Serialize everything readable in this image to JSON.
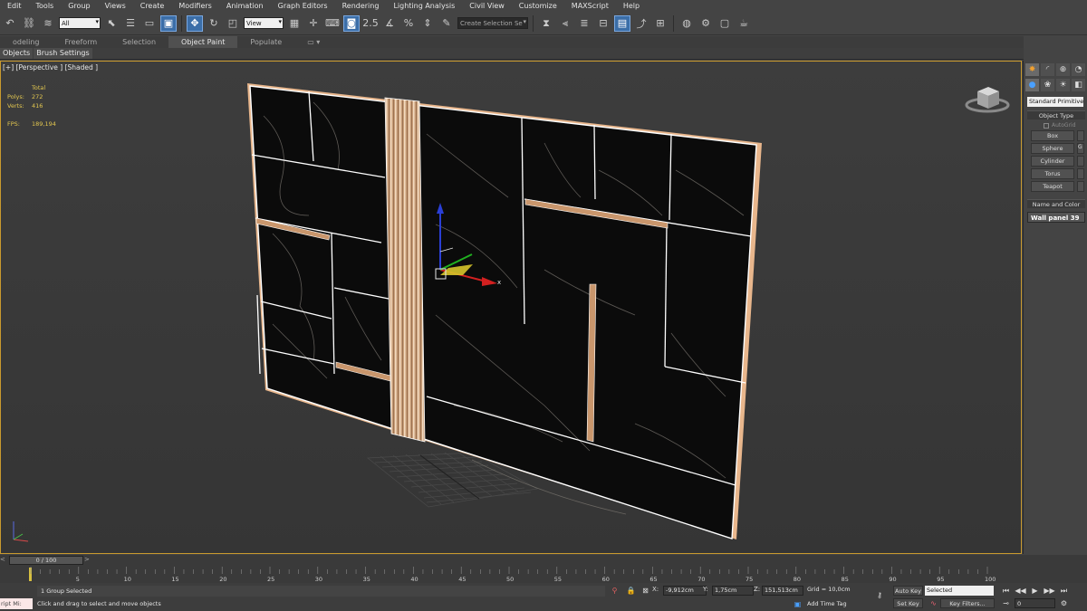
{
  "menu": [
    "Edit",
    "Tools",
    "Group",
    "Views",
    "Create",
    "Modifiers",
    "Animation",
    "Graph Editors",
    "Rendering",
    "Lighting Analysis",
    "Civil View",
    "Customize",
    "MAXScript",
    "Help"
  ],
  "toolbar": {
    "filter_value": "All",
    "refcoord_value": "View",
    "snap_label": "2.5",
    "selection_set_placeholder": "Create Selection Se"
  },
  "ribbon": {
    "tabs": [
      "odeling",
      "Freeform",
      "Selection",
      "Object Paint",
      "Populate"
    ],
    "active_tab": "Object Paint",
    "sub_tabs": [
      "Objects",
      "Brush Settings"
    ]
  },
  "viewport": {
    "label": "[+] [Perspective ] [Shaded ]",
    "stats": {
      "header": "Total",
      "polys_label": "Polys:",
      "polys": "272",
      "verts_label": "Verts:",
      "verts": "416",
      "fps_label": "FPS:",
      "fps": "189,194"
    },
    "gizmo_x_label": "x"
  },
  "command_panel": {
    "dropdown": "Standard Primitives",
    "object_type_header": "Object Type",
    "autogrid_label": "AutoGrid",
    "buttons": [
      "Box",
      "Sphere",
      "Cylinder",
      "Torus",
      "Teapot"
    ],
    "right_partial_labels": [
      "",
      "G",
      "",
      "",
      ""
    ],
    "name_header": "Name and Color",
    "object_name": "Wall panel 39"
  },
  "timeline": {
    "frame_display": "0 / 100",
    "prev": "<",
    "next": ">",
    "ticks": [
      "5",
      "10",
      "15",
      "20",
      "25",
      "30",
      "35",
      "40",
      "45",
      "50",
      "55",
      "60",
      "65",
      "70",
      "75",
      "80",
      "85",
      "90",
      "95",
      "100"
    ]
  },
  "status": {
    "maxscript_label": "ript Mi:",
    "selection_text": "1 Group Selected",
    "prompt_text": "Click and drag to select and move objects",
    "x_label": "X:",
    "x_value": "-9,912cm",
    "y_label": "Y:",
    "y_value": "1,75cm",
    "z_label": "Z:",
    "z_value": "151,513cm",
    "grid_label": "Grid = 10,0cm",
    "add_time_tag": "Add Time Tag",
    "auto_key": "Auto Key",
    "set_key": "Set Key",
    "key_mode_value": "Selected",
    "key_filters": "Key Filters...",
    "frame_value": "0"
  }
}
